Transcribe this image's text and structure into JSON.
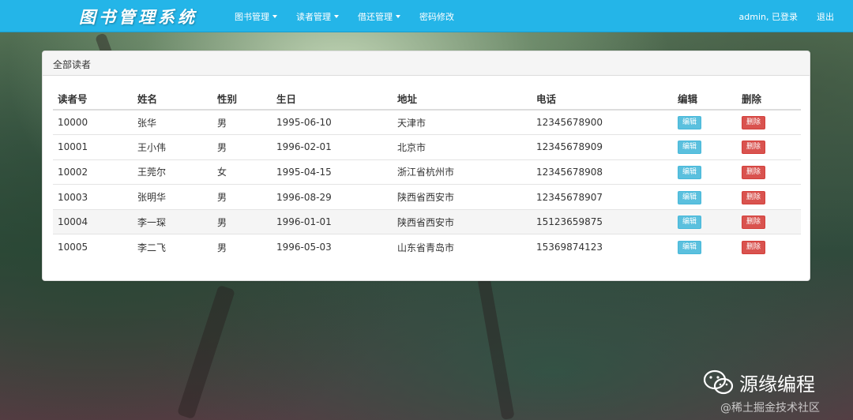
{
  "brand": "图书管理系统",
  "nav": {
    "items": [
      {
        "label": "图书管理",
        "dropdown": true
      },
      {
        "label": "读者管理",
        "dropdown": true
      },
      {
        "label": "借还管理",
        "dropdown": true
      },
      {
        "label": "密码修改",
        "dropdown": false
      }
    ],
    "user_status": "admin, 已登录",
    "logout": "退出"
  },
  "panel": {
    "title": "全部读者",
    "columns": [
      "读者号",
      "姓名",
      "性别",
      "生日",
      "地址",
      "电话",
      "编辑",
      "删除"
    ],
    "rows": [
      {
        "id": "10000",
        "name": "张华",
        "gender": "男",
        "birthday": "1995-06-10",
        "address": "天津市",
        "phone": "12345678900",
        "edit": "编辑",
        "delete": "删除"
      },
      {
        "id": "10001",
        "name": "王小伟",
        "gender": "男",
        "birthday": "1996-02-01",
        "address": "北京市",
        "phone": "12345678909",
        "edit": "编辑",
        "delete": "删除"
      },
      {
        "id": "10002",
        "name": "王莞尔",
        "gender": "女",
        "birthday": "1995-04-15",
        "address": "浙江省杭州市",
        "phone": "12345678908",
        "edit": "编辑",
        "delete": "删除"
      },
      {
        "id": "10003",
        "name": "张明华",
        "gender": "男",
        "birthday": "1996-08-29",
        "address": "陕西省西安市",
        "phone": "12345678907",
        "edit": "编辑",
        "delete": "删除"
      },
      {
        "id": "10004",
        "name": "李一琛",
        "gender": "男",
        "birthday": "1996-01-01",
        "address": "陕西省西安市",
        "phone": "15123659875",
        "edit": "编辑",
        "delete": "删除"
      },
      {
        "id": "10005",
        "name": "李二飞",
        "gender": "男",
        "birthday": "1996-05-03",
        "address": "山东省青岛市",
        "phone": "15369874123",
        "edit": "编辑",
        "delete": "删除"
      }
    ]
  },
  "watermark": {
    "title": "源缘编程",
    "site": "@稀土掘金技术社区"
  },
  "colors": {
    "navbar": "#24b5e8",
    "edit_button": "#5bc0de",
    "delete_button": "#d9534f"
  }
}
